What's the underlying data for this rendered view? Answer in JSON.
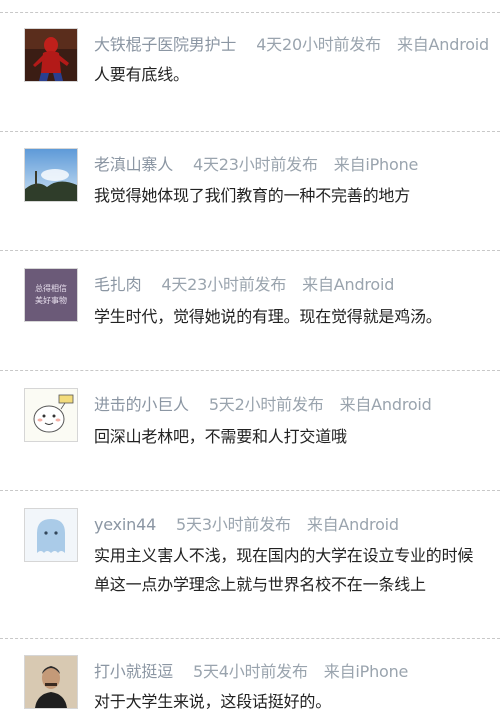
{
  "comments": [
    {
      "username": "大铁棍子医院男护士",
      "time": "4天20小时前发布",
      "source": "来自Android",
      "text": [
        "人要有底线。"
      ]
    },
    {
      "username": "老滇山寨人",
      "time": "4天23小时前发布",
      "source": "来自iPhone",
      "text": [
        "我觉得她体现了我们教育的一种不完善的地方"
      ]
    },
    {
      "username": "毛扎肉",
      "time": "4天23小时前发布",
      "source": "来自Android",
      "text": [
        "学生时代，觉得她说的有理。现在觉得就是鸡汤。"
      ],
      "avatar_text": [
        "总得相信",
        "美好事物"
      ]
    },
    {
      "username": "进击的小巨人",
      "time": "5天2小时前发布",
      "source": "来自Android",
      "text": [
        "回深山老林吧，不需要和人打交道哦"
      ]
    },
    {
      "username": "yexin44",
      "time": "5天3小时前发布",
      "source": "来自Android",
      "text": [
        "实用主义害人不浅，现在国内的大学在设立专业的时候",
        "单这一点办学理念上就与世界名校不在一条线上"
      ]
    },
    {
      "username": "打小就挺逗",
      "time": "5天4小时前发布",
      "source": "来自iPhone",
      "text": [
        "对于大学生来说，这段话挺好的。"
      ]
    }
  ],
  "colors": {
    "meta": "#9aa4ae",
    "text": "#222222",
    "separator": "#c8c8c8"
  },
  "icons": [
    "avatar-spiderman",
    "avatar-sky",
    "avatar-text-card",
    "avatar-cartoon",
    "avatar-ghost",
    "avatar-portrait"
  ]
}
